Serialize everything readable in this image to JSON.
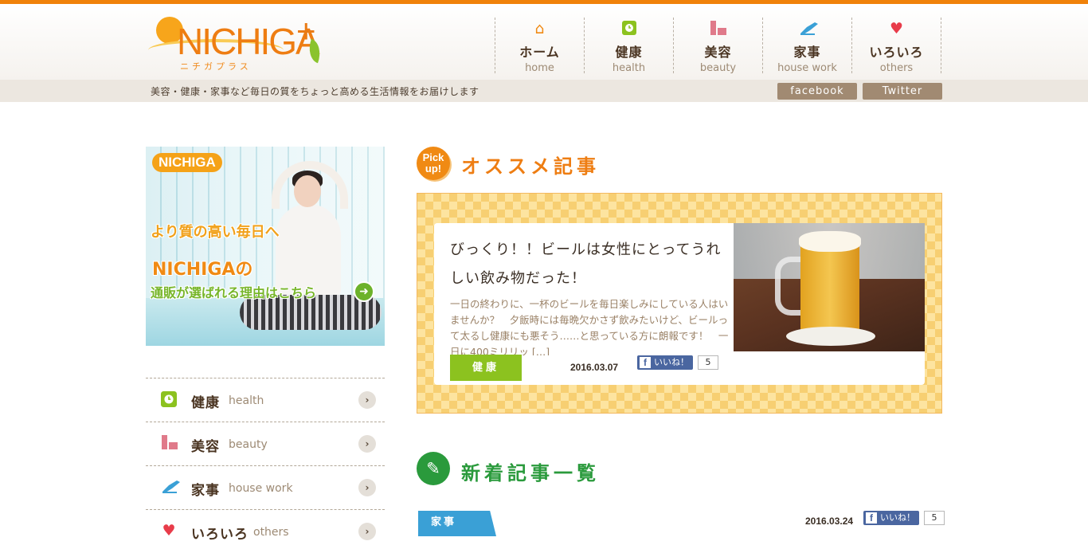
{
  "brand": {
    "logo_text": "NICHIGA",
    "logo_sub": "ニチガプラス",
    "tagline": "美容・健康・家事など毎日の質をちょっと高める生活情報をお届けします",
    "accent_color": "#f0820a"
  },
  "global_nav": [
    {
      "jp": "ホーム",
      "en": "home",
      "icon": "house-icon",
      "color": "#f08a14"
    },
    {
      "jp": "健康",
      "en": "health",
      "icon": "clock-icon",
      "color": "#8cc21f"
    },
    {
      "jp": "美容",
      "en": "beauty",
      "icon": "cosmetics-icon",
      "color": "#e07a8a"
    },
    {
      "jp": "家事",
      "en": "house work",
      "icon": "shoe-icon",
      "color": "#3aa0d6"
    },
    {
      "jp": "いろいろ",
      "en": "others",
      "icon": "heart-icon",
      "color": "#e83c4a"
    }
  ],
  "sns": {
    "facebook": "facebook",
    "twitter": "Twitter"
  },
  "banner": {
    "logo": "NICHIGA",
    "line1": "より質の高い毎日へ",
    "line2": "NICHIGAの",
    "line3": "通販が選ばれる理由はこちら"
  },
  "side_nav": [
    {
      "jp": "健康",
      "en": "health",
      "icon": "clock-icon"
    },
    {
      "jp": "美容",
      "en": "beauty",
      "icon": "cosmetics-icon"
    },
    {
      "jp": "家事",
      "en": "house work",
      "icon": "shoe-icon"
    },
    {
      "jp": "いろいろ",
      "en": "others",
      "icon": "heart-icon"
    }
  ],
  "pickup": {
    "badge_line1": "Pick",
    "badge_line2": "up!",
    "section_title": "オススメ記事",
    "article": {
      "title": "びっくり！！ビールは女性にとってうれしい飲み物だった！",
      "excerpt": "一日の終わりに、一杯のビールを毎日楽しみにしている人はいませんか？　夕飯時には毎晩欠かさず飲みたいけど、ビールって太るし健康にも悪そう……と思っている方に朗報です！　一日に400ミリリッ […]",
      "category": "健康",
      "date": "2016.03.07",
      "like_label": "いいね！",
      "like_count": "5"
    }
  },
  "new_articles": {
    "section_title": "新着記事一覧",
    "first": {
      "category": "家事",
      "date": "2016.03.24",
      "like_label": "いいね！",
      "like_count": "5"
    }
  }
}
